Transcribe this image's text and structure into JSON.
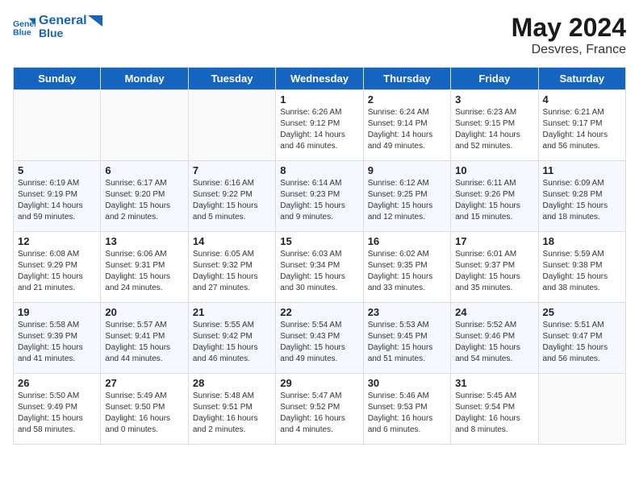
{
  "header": {
    "logo_line1": "General",
    "logo_line2": "Blue",
    "month": "May 2024",
    "location": "Desvres, France"
  },
  "weekdays": [
    "Sunday",
    "Monday",
    "Tuesday",
    "Wednesday",
    "Thursday",
    "Friday",
    "Saturday"
  ],
  "weeks": [
    [
      {
        "day": "",
        "sunrise": "",
        "sunset": "",
        "daylight": ""
      },
      {
        "day": "",
        "sunrise": "",
        "sunset": "",
        "daylight": ""
      },
      {
        "day": "",
        "sunrise": "",
        "sunset": "",
        "daylight": ""
      },
      {
        "day": "1",
        "sunrise": "Sunrise: 6:26 AM",
        "sunset": "Sunset: 9:12 PM",
        "daylight": "Daylight: 14 hours and 46 minutes."
      },
      {
        "day": "2",
        "sunrise": "Sunrise: 6:24 AM",
        "sunset": "Sunset: 9:14 PM",
        "daylight": "Daylight: 14 hours and 49 minutes."
      },
      {
        "day": "3",
        "sunrise": "Sunrise: 6:23 AM",
        "sunset": "Sunset: 9:15 PM",
        "daylight": "Daylight: 14 hours and 52 minutes."
      },
      {
        "day": "4",
        "sunrise": "Sunrise: 6:21 AM",
        "sunset": "Sunset: 9:17 PM",
        "daylight": "Daylight: 14 hours and 56 minutes."
      }
    ],
    [
      {
        "day": "5",
        "sunrise": "Sunrise: 6:19 AM",
        "sunset": "Sunset: 9:19 PM",
        "daylight": "Daylight: 14 hours and 59 minutes."
      },
      {
        "day": "6",
        "sunrise": "Sunrise: 6:17 AM",
        "sunset": "Sunset: 9:20 PM",
        "daylight": "Daylight: 15 hours and 2 minutes."
      },
      {
        "day": "7",
        "sunrise": "Sunrise: 6:16 AM",
        "sunset": "Sunset: 9:22 PM",
        "daylight": "Daylight: 15 hours and 5 minutes."
      },
      {
        "day": "8",
        "sunrise": "Sunrise: 6:14 AM",
        "sunset": "Sunset: 9:23 PM",
        "daylight": "Daylight: 15 hours and 9 minutes."
      },
      {
        "day": "9",
        "sunrise": "Sunrise: 6:12 AM",
        "sunset": "Sunset: 9:25 PM",
        "daylight": "Daylight: 15 hours and 12 minutes."
      },
      {
        "day": "10",
        "sunrise": "Sunrise: 6:11 AM",
        "sunset": "Sunset: 9:26 PM",
        "daylight": "Daylight: 15 hours and 15 minutes."
      },
      {
        "day": "11",
        "sunrise": "Sunrise: 6:09 AM",
        "sunset": "Sunset: 9:28 PM",
        "daylight": "Daylight: 15 hours and 18 minutes."
      }
    ],
    [
      {
        "day": "12",
        "sunrise": "Sunrise: 6:08 AM",
        "sunset": "Sunset: 9:29 PM",
        "daylight": "Daylight: 15 hours and 21 minutes."
      },
      {
        "day": "13",
        "sunrise": "Sunrise: 6:06 AM",
        "sunset": "Sunset: 9:31 PM",
        "daylight": "Daylight: 15 hours and 24 minutes."
      },
      {
        "day": "14",
        "sunrise": "Sunrise: 6:05 AM",
        "sunset": "Sunset: 9:32 PM",
        "daylight": "Daylight: 15 hours and 27 minutes."
      },
      {
        "day": "15",
        "sunrise": "Sunrise: 6:03 AM",
        "sunset": "Sunset: 9:34 PM",
        "daylight": "Daylight: 15 hours and 30 minutes."
      },
      {
        "day": "16",
        "sunrise": "Sunrise: 6:02 AM",
        "sunset": "Sunset: 9:35 PM",
        "daylight": "Daylight: 15 hours and 33 minutes."
      },
      {
        "day": "17",
        "sunrise": "Sunrise: 6:01 AM",
        "sunset": "Sunset: 9:37 PM",
        "daylight": "Daylight: 15 hours and 35 minutes."
      },
      {
        "day": "18",
        "sunrise": "Sunrise: 5:59 AM",
        "sunset": "Sunset: 9:38 PM",
        "daylight": "Daylight: 15 hours and 38 minutes."
      }
    ],
    [
      {
        "day": "19",
        "sunrise": "Sunrise: 5:58 AM",
        "sunset": "Sunset: 9:39 PM",
        "daylight": "Daylight: 15 hours and 41 minutes."
      },
      {
        "day": "20",
        "sunrise": "Sunrise: 5:57 AM",
        "sunset": "Sunset: 9:41 PM",
        "daylight": "Daylight: 15 hours and 44 minutes."
      },
      {
        "day": "21",
        "sunrise": "Sunrise: 5:55 AM",
        "sunset": "Sunset: 9:42 PM",
        "daylight": "Daylight: 15 hours and 46 minutes."
      },
      {
        "day": "22",
        "sunrise": "Sunrise: 5:54 AM",
        "sunset": "Sunset: 9:43 PM",
        "daylight": "Daylight: 15 hours and 49 minutes."
      },
      {
        "day": "23",
        "sunrise": "Sunrise: 5:53 AM",
        "sunset": "Sunset: 9:45 PM",
        "daylight": "Daylight: 15 hours and 51 minutes."
      },
      {
        "day": "24",
        "sunrise": "Sunrise: 5:52 AM",
        "sunset": "Sunset: 9:46 PM",
        "daylight": "Daylight: 15 hours and 54 minutes."
      },
      {
        "day": "25",
        "sunrise": "Sunrise: 5:51 AM",
        "sunset": "Sunset: 9:47 PM",
        "daylight": "Daylight: 15 hours and 56 minutes."
      }
    ],
    [
      {
        "day": "26",
        "sunrise": "Sunrise: 5:50 AM",
        "sunset": "Sunset: 9:49 PM",
        "daylight": "Daylight: 15 hours and 58 minutes."
      },
      {
        "day": "27",
        "sunrise": "Sunrise: 5:49 AM",
        "sunset": "Sunset: 9:50 PM",
        "daylight": "Daylight: 16 hours and 0 minutes."
      },
      {
        "day": "28",
        "sunrise": "Sunrise: 5:48 AM",
        "sunset": "Sunset: 9:51 PM",
        "daylight": "Daylight: 16 hours and 2 minutes."
      },
      {
        "day": "29",
        "sunrise": "Sunrise: 5:47 AM",
        "sunset": "Sunset: 9:52 PM",
        "daylight": "Daylight: 16 hours and 4 minutes."
      },
      {
        "day": "30",
        "sunrise": "Sunrise: 5:46 AM",
        "sunset": "Sunset: 9:53 PM",
        "daylight": "Daylight: 16 hours and 6 minutes."
      },
      {
        "day": "31",
        "sunrise": "Sunrise: 5:45 AM",
        "sunset": "Sunset: 9:54 PM",
        "daylight": "Daylight: 16 hours and 8 minutes."
      },
      {
        "day": "",
        "sunrise": "",
        "sunset": "",
        "daylight": ""
      }
    ]
  ]
}
